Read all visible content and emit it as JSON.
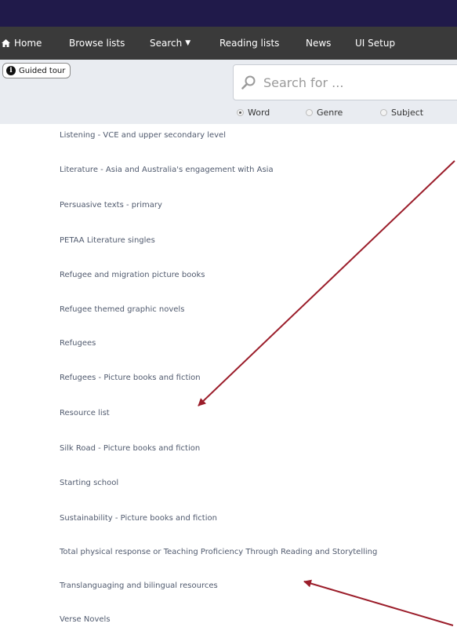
{
  "nav": {
    "items": [
      {
        "label": "Home"
      },
      {
        "label": "Browse lists"
      },
      {
        "label": "Search"
      },
      {
        "label": "Reading lists"
      },
      {
        "label": "News"
      },
      {
        "label": "UI Setup"
      }
    ]
  },
  "toolbar": {
    "tour_label": "Guided tour",
    "search_placeholder": "Search for ...",
    "radio": [
      {
        "label": "Word",
        "checked": true
      },
      {
        "label": "Genre",
        "checked": false
      },
      {
        "label": "Subject",
        "checked": false
      }
    ]
  },
  "lists": [
    "Listening - VCE and upper secondary level",
    "Literature - Asia and Australia's engagement with Asia",
    "Persuasive texts - primary",
    "PETAA Literature singles",
    "Refugee and migration picture books",
    "Refugee themed graphic novels",
    "Refugees",
    "Refugees - Picture books and fiction",
    "Resource list",
    "Silk Road - Picture books and fiction",
    "Starting school",
    "Sustainability - Picture books and fiction",
    "Total physical response or Teaching Proficiency Through Reading and Storytelling",
    "Translanguaging and bilingual resources",
    "Verse Novels"
  ],
  "colors": {
    "top_bar": "#201a4a",
    "nav_bar": "#3a3a3a",
    "toolbar_bg": "#e9ecf1",
    "link_text": "#505a6e",
    "arrow": "#9b1d2a"
  }
}
